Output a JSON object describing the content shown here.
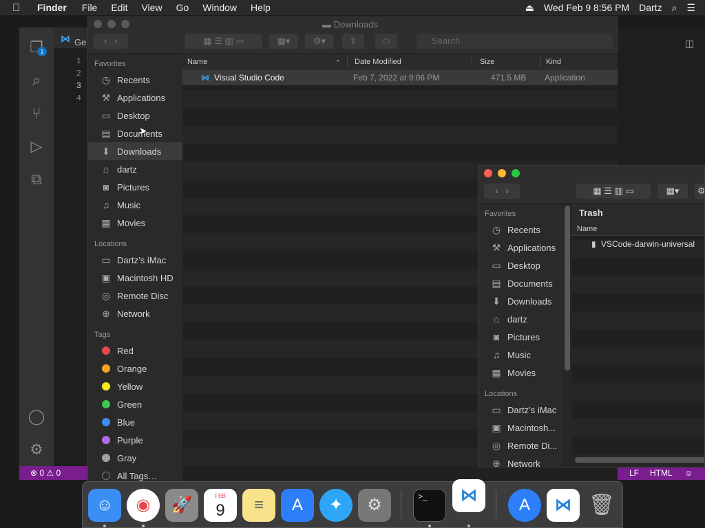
{
  "menubar": {
    "apple": "",
    "app": "Finder",
    "items": [
      "File",
      "Edit",
      "View",
      "Go",
      "Window",
      "Help"
    ],
    "datetime": "Wed Feb 9  8:56 PM",
    "user": "Dartz"
  },
  "vscode": {
    "tab_label": "Ge",
    "badge": "1",
    "line_numbers": [
      "1",
      "2",
      "3",
      "4"
    ],
    "status": {
      "problems": "⊗ 0 ⚠ 0",
      "eol": "LF",
      "language": "HTML"
    }
  },
  "finder_downloads": {
    "title": "Downloads",
    "search_placeholder": "Search",
    "sidebar": {
      "favorites_header": "Favorites",
      "favorites": [
        "Recents",
        "Applications",
        "Desktop",
        "Documents",
        "Downloads",
        "dartz",
        "Pictures",
        "Music",
        "Movies"
      ],
      "locations_header": "Locations",
      "locations": [
        "Dartz’s iMac",
        "Macintosh HD",
        "Remote Disc",
        "Network"
      ],
      "tags_header": "Tags",
      "tags": [
        {
          "name": "Red",
          "color": "#e5484d"
        },
        {
          "name": "Orange",
          "color": "#f5a623"
        },
        {
          "name": "Yellow",
          "color": "#f8e71c"
        },
        {
          "name": "Green",
          "color": "#3cc84a"
        },
        {
          "name": "Blue",
          "color": "#3a8ef6"
        },
        {
          "name": "Purple",
          "color": "#b56ae0"
        },
        {
          "name": "Gray",
          "color": "#a0a0a0"
        },
        {
          "name": "All Tags…",
          "color": ""
        }
      ]
    },
    "columns": [
      "Name",
      "Date Modified",
      "Size",
      "Kind"
    ],
    "rows": [
      {
        "name": "Visual Studio Code",
        "date": "Feb 7, 2022 at 9:06 PM",
        "size": "471.5 MB",
        "kind": "Application"
      }
    ]
  },
  "finder_trash": {
    "title": "Trash",
    "sidebar": {
      "favorites_header": "Favorites",
      "favorites": [
        "Recents",
        "Applications",
        "Desktop",
        "Documents",
        "Downloads",
        "dartz",
        "Pictures",
        "Music",
        "Movies"
      ],
      "locations_header": "Locations",
      "locations": [
        "Dartz’s iMac",
        "Macintosh...",
        "Remote Di...",
        "Network"
      ]
    },
    "column_name": "Name",
    "rows": [
      "VSCode-darwin-universal"
    ]
  },
  "dock": {
    "apps": [
      "finder-icon",
      "chrome-icon",
      "launchpad-icon",
      "calendar-icon",
      "notes-icon",
      "app-store-icon",
      "safari-icon",
      "system-preferences-icon",
      "terminal-icon",
      "vscode-icon",
      "app-store-installer-icon",
      "vscode-icon-2",
      "trash-icon"
    ],
    "calendar_month": "FEB",
    "calendar_day": "9"
  }
}
